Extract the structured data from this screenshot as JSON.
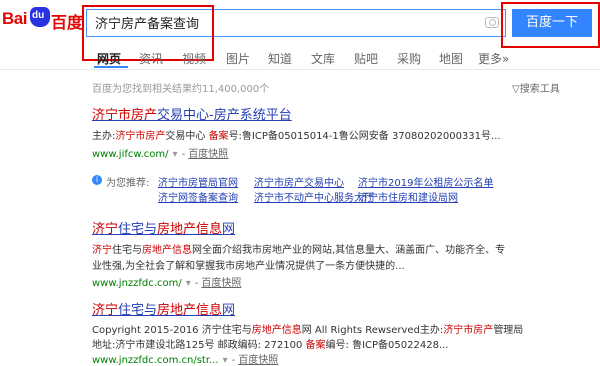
{
  "logo": {
    "text_bai": "Bai",
    "text_paw": "du",
    "text_cn": "百度"
  },
  "search": {
    "query": "济宁房产备案查询",
    "button_label": "百度一下"
  },
  "tabs": [
    "网页",
    "资讯",
    "视频",
    "图片",
    "知道",
    "文库",
    "贴吧",
    "采购",
    "地图",
    "更多»"
  ],
  "stats": "百度为您找到相关结果约11,400,000个",
  "tools_label": "▽搜索工具",
  "results": [
    {
      "title_parts": [
        "济宁市房产",
        "交易中心-房产系统平台"
      ],
      "lines": [
        [
          "主办:",
          "济宁市房产",
          "交易中心 ",
          "备案",
          "号:鲁ICP备05015014-1鲁公网安备 37080202000331号..."
        ]
      ],
      "url": "www.jifcw.com/",
      "snapshot": "百度快照"
    },
    {
      "title_parts": [
        "济宁",
        "住宅与",
        "房地产信息",
        "网"
      ],
      "lines": [
        [
          "济宁",
          "住宅与",
          "房地产信息",
          "网全面介绍我市房地产业的网站,其信息量大、涵盖面广、功能齐全、专"
        ],
        [
          "业性强,为全社会了解和掌握我市房地产业情况提供了一条方便快捷的..."
        ]
      ],
      "url": "www.jnzzfdc.com/",
      "snapshot": "百度快照"
    },
    {
      "title_parts": [
        "济宁",
        "住宅与",
        "房地产信息",
        "网"
      ],
      "lines": [
        [
          "Copyright 2015-2016 济宁住宅与",
          "房地产信息",
          "网 All Rights Rewserved主办:",
          "济宁市房产",
          "管理局"
        ],
        [
          "地址:济宁市建设北路125号 邮政编码: 272100 ",
          "备案",
          "编号: 鲁ICP备05022428..."
        ]
      ],
      "url": "www.jnzzfdc.com.cn/str...",
      "snapshot": "百度快照"
    }
  ],
  "recommend": {
    "icon": "i",
    "label": "为您推荐:",
    "links": [
      "济宁市房管局官网",
      "济宁市房产交易中心",
      "济宁市2019年公租房公示名单",
      "济宁网签备案查询",
      "济宁市不动产中心服务大厅",
      "济宁市住房和建设局网"
    ]
  },
  "colors": {
    "link": "#2440b3",
    "highlight": "#cc0000",
    "url": "#008000",
    "button": "#3385ff",
    "annotation": "#e60000"
  }
}
